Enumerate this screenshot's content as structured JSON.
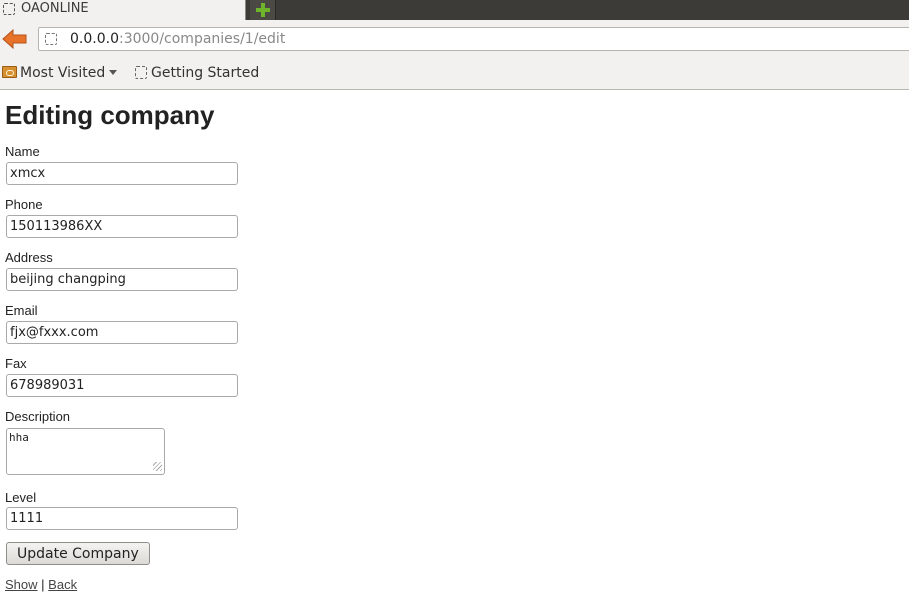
{
  "browser": {
    "tab_title": "OAONLINE",
    "url_host": "0.0.0.0",
    "url_rest": ":3000/companies/1/edit",
    "bookmarks": [
      {
        "label": "Most Visited"
      },
      {
        "label": "Getting Started"
      }
    ]
  },
  "page": {
    "heading": "Editing company",
    "fields": {
      "name": {
        "label": "Name",
        "value": "xmcx"
      },
      "phone": {
        "label": "Phone",
        "value": "150113986XX"
      },
      "address": {
        "label": "Address",
        "value": "beijing changping"
      },
      "email": {
        "label": "Email",
        "value": "fjx@fxxx.com"
      },
      "fax": {
        "label": "Fax",
        "value": "678989031"
      },
      "description": {
        "label": "Description",
        "value": "hha"
      },
      "level": {
        "label": "Level",
        "value": "1111"
      }
    },
    "submit_label": "Update Company",
    "links": {
      "show": "Show",
      "separator": "|",
      "back": "Back"
    }
  },
  "colors": {
    "tabstrip": "#3c3b37",
    "toolbar": "#f2f1f0",
    "back_arrow": "#e8722a",
    "new_tab_plus": "#6fb52c"
  },
  "icons": {
    "back": "back-arrow-icon",
    "new_tab": "plus-icon",
    "favicon": "blank-page-icon",
    "folder": "folder-icon",
    "dropdown": "chevron-down-icon"
  }
}
